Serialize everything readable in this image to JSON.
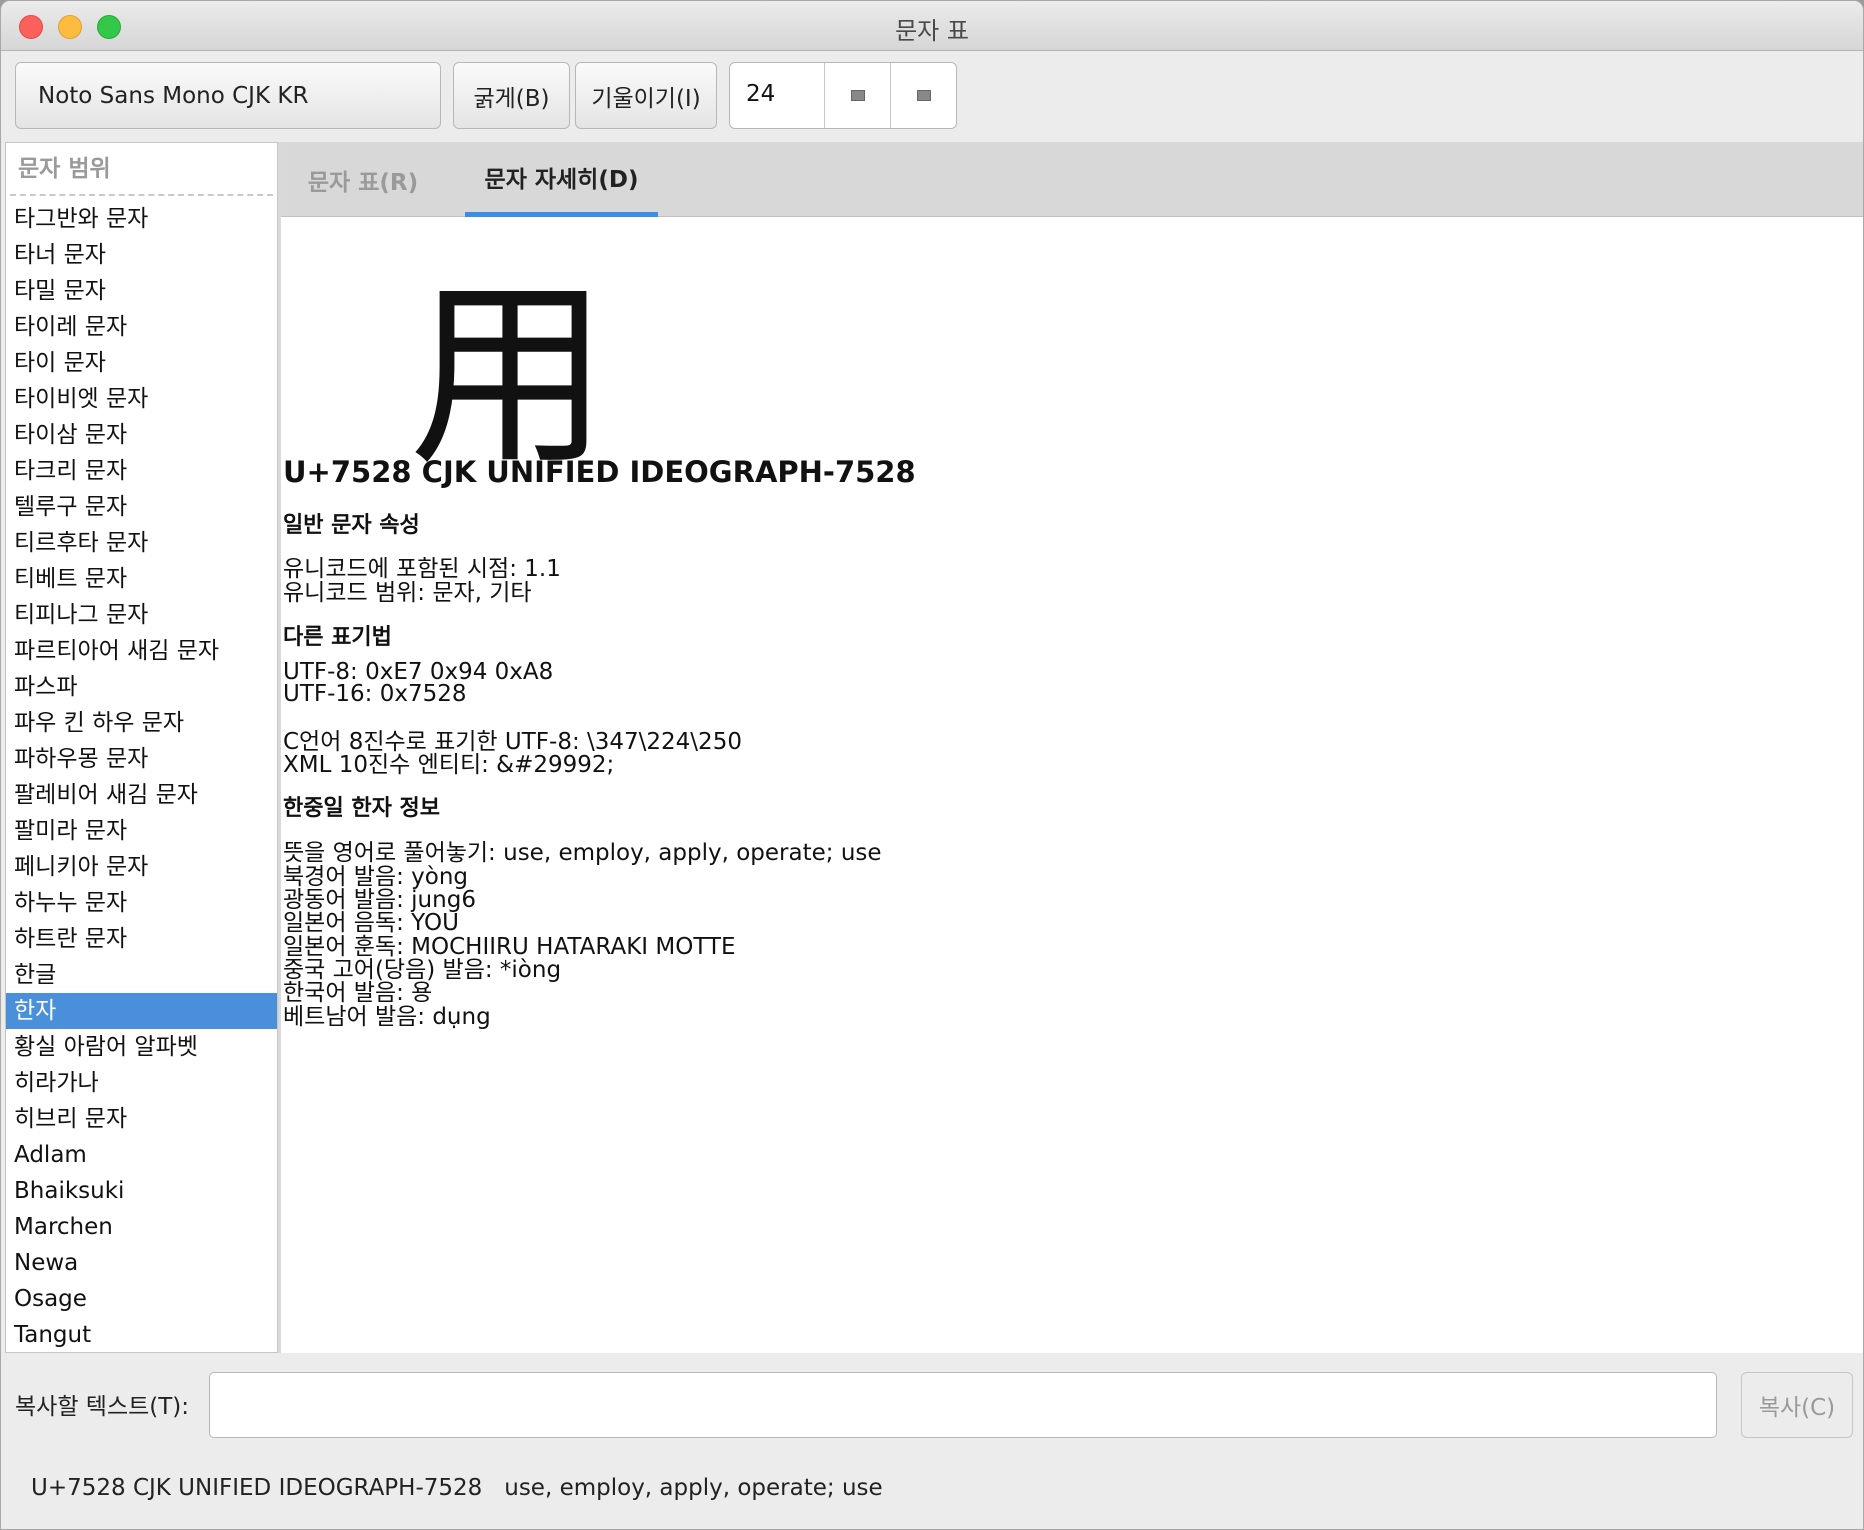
{
  "window": {
    "title": "문자 표"
  },
  "toolbar": {
    "font_name": "Noto Sans Mono CJK KR",
    "bold_label": "굵게(B)",
    "italic_label": "기울이기(I)",
    "size_value": "24"
  },
  "left": {
    "search_placeholder": "문자 범위",
    "items": [
      "타그반와 문자",
      "타너 문자",
      "타밀 문자",
      "타이레 문자",
      "타이 문자",
      "타이비엣 문자",
      "타이삼 문자",
      "타크리 문자",
      "텔루구 문자",
      "티르후타 문자",
      "티베트 문자",
      "티피나그 문자",
      "파르티아어 새김 문자",
      "파스파",
      "파우 킨 하우 문자",
      "파하우몽 문자",
      "팔레비어 새김 문자",
      "팔미라 문자",
      "페니키아 문자",
      "하누누 문자",
      "하트란 문자",
      "한글",
      "한자",
      "황실 아람어 알파벳",
      "히라가나",
      "히브리 문자",
      "Adlam",
      "Bhaiksuki",
      "Marchen",
      "Newa",
      "Osage",
      "Tangut"
    ],
    "selected_item": "한자"
  },
  "tabs": {
    "chart": "문자 표(R)",
    "detail": "문자 자세히(D)"
  },
  "detail": {
    "glyph": "用",
    "heading": "U+7528 CJK UNIFIED IDEOGRAPH-7528",
    "general_title": "일반 문자 속성",
    "unicode_version": "유니코드에 포함된 시점: 1.1",
    "unicode_category": "유니코드 범위: 문자, 기타",
    "other_title": "다른 표기법",
    "utf8": "UTF-8: 0xE7 0x94 0xA8",
    "utf16": "UTF-16: 0x7528",
    "c_octal": "C언어 8진수로 표기한 UTF-8: \\347\\224\\250",
    "xml_entity": "XML 10진수 엔티티: &#29992;",
    "cjk_title": "한중일 한자 정보",
    "definition": "뜻을 영어로 풀어놓기: use, employ, apply, operate; use",
    "mandarin": "북경어 발음: yòng",
    "cantonese": "광동어 발음: jung6",
    "japanese_on": "일본어 음독: YOU",
    "japanese_kun": "일본어 훈독: MOCHIIRU HATARAKI MOTTE",
    "tang": "중국 고어(당음) 발음: *iòng",
    "korean": "한국어 발음: 용",
    "vietnamese": "베트남어 발음: dụng"
  },
  "bottom": {
    "copy_label": "복사할 텍스트(T):",
    "copy_value": "",
    "copy_button": "복사(C)",
    "status_code": "U+7528 CJK UNIFIED IDEOGRAPH-7528",
    "status_meaning": "use, employ, apply, operate; use"
  },
  "colors": {
    "selection": "#4a8fd9",
    "tab_underline": "#3b8ee8",
    "close": "#fc605c",
    "minimize": "#fdbc40",
    "maximize": "#34c84a"
  }
}
